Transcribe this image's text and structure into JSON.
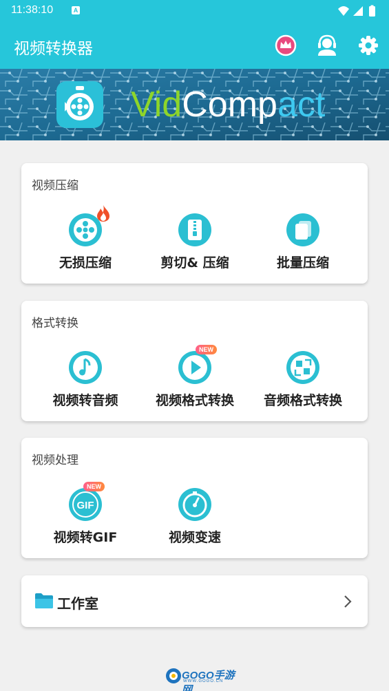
{
  "status_bar": {
    "time": "11:38:10",
    "notification_letter": "A"
  },
  "app_bar": {
    "title": "视频转换器",
    "icons": [
      "crown-icon",
      "customer-service-icon",
      "settings-icon"
    ]
  },
  "banner": {
    "text_vid": "Vid",
    "text_comp": "Comp",
    "text_act": "act"
  },
  "sections": [
    {
      "title": "视频压缩",
      "items": [
        {
          "label": "无损压缩",
          "icon": "film-reel-icon",
          "badge": "hot"
        },
        {
          "label": "剪切& 压缩",
          "icon": "zip-file-icon"
        },
        {
          "label": "批量压缩",
          "icon": "batch-files-icon"
        }
      ]
    },
    {
      "title": "格式转换",
      "items": [
        {
          "label": "视频转音频",
          "icon": "music-note-icon"
        },
        {
          "label": "视频格式转换",
          "icon": "play-icon",
          "badge": "NEW"
        },
        {
          "label": "音频格式转换",
          "icon": "swap-icon"
        }
      ]
    },
    {
      "title": "视频处理",
      "items": [
        {
          "label": "视频转GIF",
          "icon": "gif-icon",
          "icon_text": "GIF",
          "badge": "NEW"
        },
        {
          "label": "视频变速",
          "icon": "speedometer-icon"
        }
      ]
    }
  ],
  "studio": {
    "label": "工作室"
  },
  "watermark": {
    "text": "GOGO手游网",
    "sub": "WWW.GOGO.CN"
  },
  "colors": {
    "primary": "#26c6da",
    "icon_teal": "#2bbfd2",
    "accent_pink": "#e84a7f"
  }
}
